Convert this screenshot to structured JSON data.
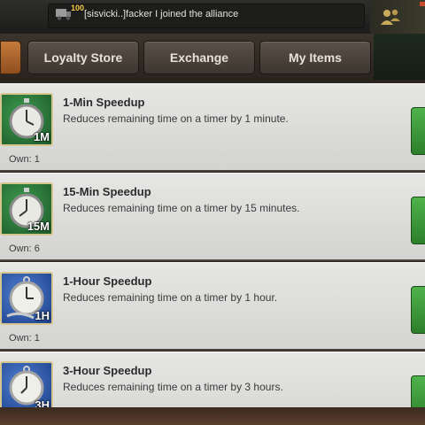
{
  "chat": {
    "badge": "100",
    "message": "[sisvicki..]facker I joined the alliance"
  },
  "tabs": [
    {
      "label": "Loyalty Store"
    },
    {
      "label": "Exchange"
    },
    {
      "label": "My Items"
    }
  ],
  "items": [
    {
      "title": "1-Min Speedup",
      "description": "Reduces remaining time on a timer by 1 minute.",
      "icon_label": "1M",
      "own": "Own: 1",
      "icon": "stopwatch-icon",
      "icon_color": "#2f8a3f"
    },
    {
      "title": "15-Min Speedup",
      "description": "Reduces remaining time on a timer by 15 minutes.",
      "icon_label": "15M",
      "own": "Own: 6",
      "icon": "stopwatch-icon",
      "icon_color": "#2f8a3f"
    },
    {
      "title": "1-Hour Speedup",
      "description": "Reduces remaining time on a timer by 1 hour.",
      "icon_label": "1H",
      "own": "Own: 1",
      "icon": "pocket-watch-icon",
      "icon_color": "#3a66b8"
    },
    {
      "title": "3-Hour Speedup",
      "description": "Reduces remaining time on a timer by 3 hours.",
      "icon_label": "3H",
      "own": "",
      "icon": "pocket-watch-icon",
      "icon_color": "#3a66b8"
    }
  ],
  "colors": {
    "use_button": "#3e9a3b",
    "active_tab": "#b56a30"
  }
}
